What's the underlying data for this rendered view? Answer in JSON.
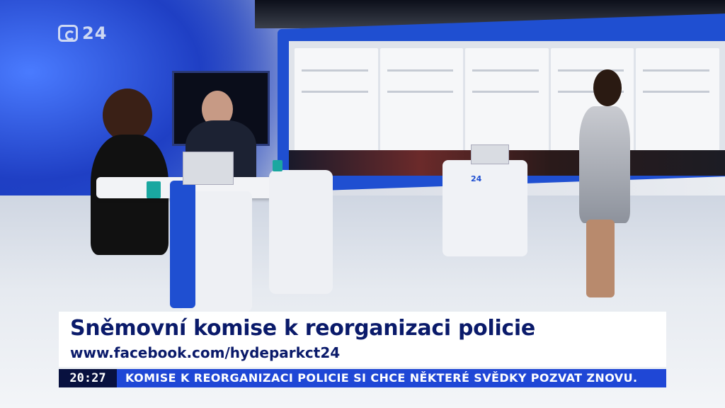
{
  "channel": {
    "logo_text": "24"
  },
  "podium": {
    "logo_text": "24"
  },
  "lower_third": {
    "headline": "Sněmovní komise k reorganizaci policie",
    "subline": "www.facebook.com/hydeparkct24"
  },
  "ticker": {
    "time": "20:27",
    "text": "KOMISE K REORGANIZACI POLICIE SI CHCE NĚKTERÉ SVĚDKY POZVAT ZNOVU."
  },
  "colors": {
    "brand_blue": "#1f47d6",
    "navy": "#08113f",
    "headline": "#0a1a6a"
  }
}
